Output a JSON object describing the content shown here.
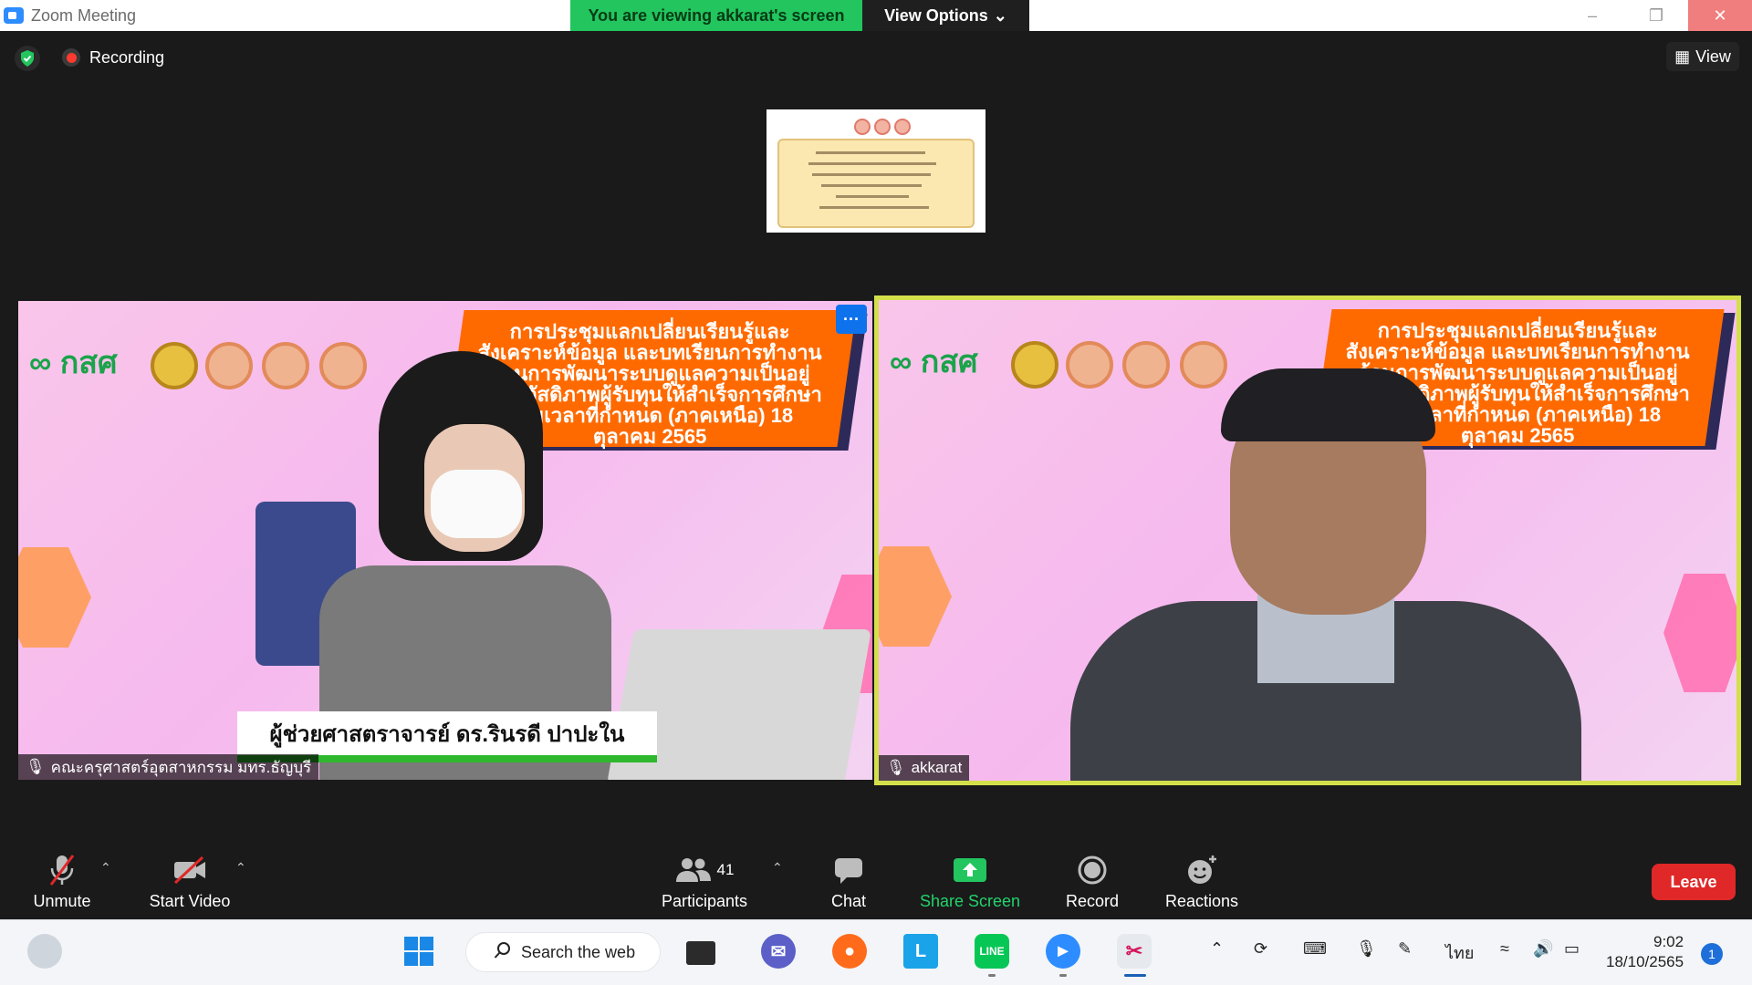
{
  "window": {
    "title": "Zoom Meeting",
    "viewing_banner": "You are viewing akkarat's screen",
    "view_options": "View Options",
    "view_options_icon": "chevron-down-icon"
  },
  "status": {
    "recording_label": "Recording",
    "view_label": "View"
  },
  "tiles": [
    {
      "banner": "การประชุมแลกเปลี่ยนเรียนรู้และสังเคราะห์ข้อมูล และบทเรียนการทำงานด้านการพัฒนาระบบดูแลความเป็นอยู่และสวัสดิภาพผู้รับทุนให้สำเร็จการศึกษาตามเวลาที่กำหนด (ภาคเหนือ) 18 ตุลาคม 2565",
      "logo": "กสศ",
      "lower_third": "ผู้ช่วยศาสตราจารย์ ดร.รินรดี ปาปะใน",
      "name": "คณะครุศาสตร์อุตสาหกรรม มทร.ธัญบุรี",
      "more": "···"
    },
    {
      "banner": "การประชุมแลกเปลี่ยนเรียนรู้และสังเคราะห์ข้อมูล และบทเรียนการทำงานด้านการพัฒนาระบบดูแลความเป็นอยู่และสวัสดิภาพผู้รับทุนให้สำเร็จการศึกษาตามเวลาที่กำหนด (ภาคเหนือ) 18 ตุลาคม 2565",
      "logo": "กสศ",
      "name": "akkarat"
    }
  ],
  "toolbar": {
    "unmute": "Unmute",
    "start_video": "Start Video",
    "participants": "Participants",
    "participants_count": "41",
    "chat": "Chat",
    "share_screen": "Share Screen",
    "record": "Record",
    "reactions": "Reactions",
    "leave": "Leave",
    "colors": {
      "share": "#22d36b",
      "leave": "#e02828"
    }
  },
  "taskbar": {
    "search": "Search the web",
    "lang": "ไทย",
    "time": "9:02",
    "date": "18/10/2565",
    "notifications": "1"
  }
}
